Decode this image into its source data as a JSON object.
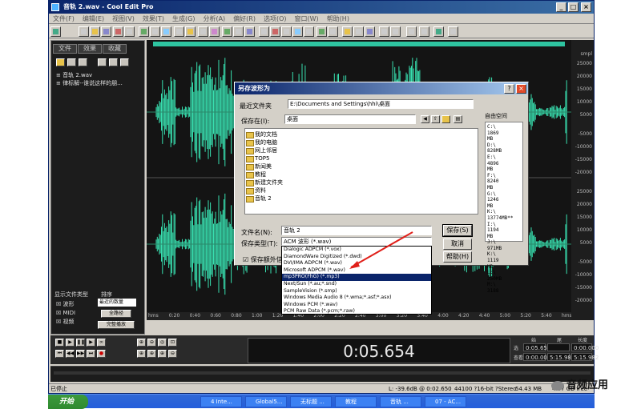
{
  "app": {
    "title": "音轨  2.wav - Cool Edit Pro"
  },
  "menu": [
    "文件(F)",
    "编辑(E)",
    "视图(V)",
    "效果(T)",
    "生成(G)",
    "分析(A)",
    "偏好(R)",
    "选项(O)",
    "窗口(W)",
    "帮助(H)"
  ],
  "left_panel": {
    "tabs": [
      "文件",
      "效果",
      "收藏"
    ],
    "files": [
      "音轨  2.wav",
      "律标解--谁说这样的朋..."
    ],
    "show_types_label": "显示文件类型",
    "sort_label": "排序",
    "sort_value": "最近的数量",
    "types": [
      "波形",
      "MIDI",
      "视频"
    ],
    "btn_full_path": "全路径",
    "btn_auto_play": "完整播放"
  },
  "dialog": {
    "title": "另存波形为",
    "recent_label": "最近文件夹",
    "recent_value": "E:\\Documents and Settings\\hhi\\桌面",
    "save_in_label": "保存在(I):",
    "save_in_value": "桌面",
    "files": [
      "我的文档",
      "我的电脑",
      "网上邻居",
      "TOP5",
      "新闻美",
      "教程",
      "新建文件夹",
      "资料",
      "音轨  2"
    ],
    "free_space_label": "自由空间",
    "free_space": [
      "C:\\",
      "1869",
      "MB",
      "D:\\",
      "828MB",
      "E:\\",
      "4896",
      "MB",
      "F:\\",
      "8240",
      "MB",
      "G:\\",
      "1246",
      "MB",
      "K:\\",
      "13774MB**",
      "I:\\",
      "1194",
      "MB",
      "J:\\",
      "971MB",
      "K:\\",
      "1119",
      "MB",
      "L:\\",
      "250MB",
      "M:\\",
      "3188"
    ],
    "filename_label": "文件名(N):",
    "filename_value": "音轨  2",
    "filetype_label": "保存类型(T):",
    "filetype_value": "ACM 波形 (*.wav)",
    "extra_label": "保存额外信",
    "save_btn": "保存(S)",
    "cancel_btn": "取消",
    "help_btn": "帮助(H)",
    "dropdown": [
      "Dialogic ADPCM (*.vox)",
      "DiamondWare Digitized (*.dwd)",
      "DVI/IMA ADPCM (*.wav)",
      "Microsoft ADPCM (*.wav)",
      "mp3PRO(FhG) (*.mp3)",
      "Next/Sun (*.au;*.snd)",
      "SampleVision (*.smp)",
      "Windows Media Audio 8 (*.wma;*.asf;*.asx)",
      "Windows PCM (*.wav)",
      "PCM Raw Data (*.pcm;*.raw)"
    ],
    "dropdown_selected": 4
  },
  "ruler": {
    "unit": "smpl",
    "labels": [
      "25000",
      "20000",
      "15000",
      "10000",
      "5000",
      "-5000",
      "-10000",
      "-15000",
      "-20000",
      "25000",
      "20000",
      "15000",
      "10000",
      "5000",
      "-5000",
      "-10000",
      "-15000",
      "-20000"
    ],
    "time_ticks": [
      "hms",
      "0:20",
      "0:40",
      "0:60",
      "0:80",
      "1:00",
      "1:20",
      "1:40",
      "2:00",
      "2:20",
      "2:40",
      "3:00",
      "3:20",
      "3:40",
      "4:00",
      "4:20",
      "4:40",
      "5:00",
      "5:20",
      "5:40",
      "hms"
    ]
  },
  "time_display": "0:05.654",
  "time_panel": {
    "start_label": "始",
    "end_label": "尾",
    "length_label": "长度",
    "sel_label": "选",
    "view_label": "查看",
    "sel_start": "0:05.654",
    "sel_end": "",
    "sel_len": "0:00.000",
    "view_start": "0:00.000",
    "view_end": "5:15.982",
    "view_len": "5:15.982"
  },
  "status": {
    "left": "已停止",
    "level": "L: -39.6dB @ 0:02.650",
    "format": "44100 ?16-bit ?Stereo",
    "size": "54.43 MB",
    "free": "4.07 GB free"
  },
  "taskbar": {
    "start": "开始",
    "tasks": [
      "4 Inte...",
      "Global5...",
      "无标题 ...",
      "教程",
      "音轨 ...",
      "07 - AC..."
    ]
  },
  "watermark": "音频应用"
}
